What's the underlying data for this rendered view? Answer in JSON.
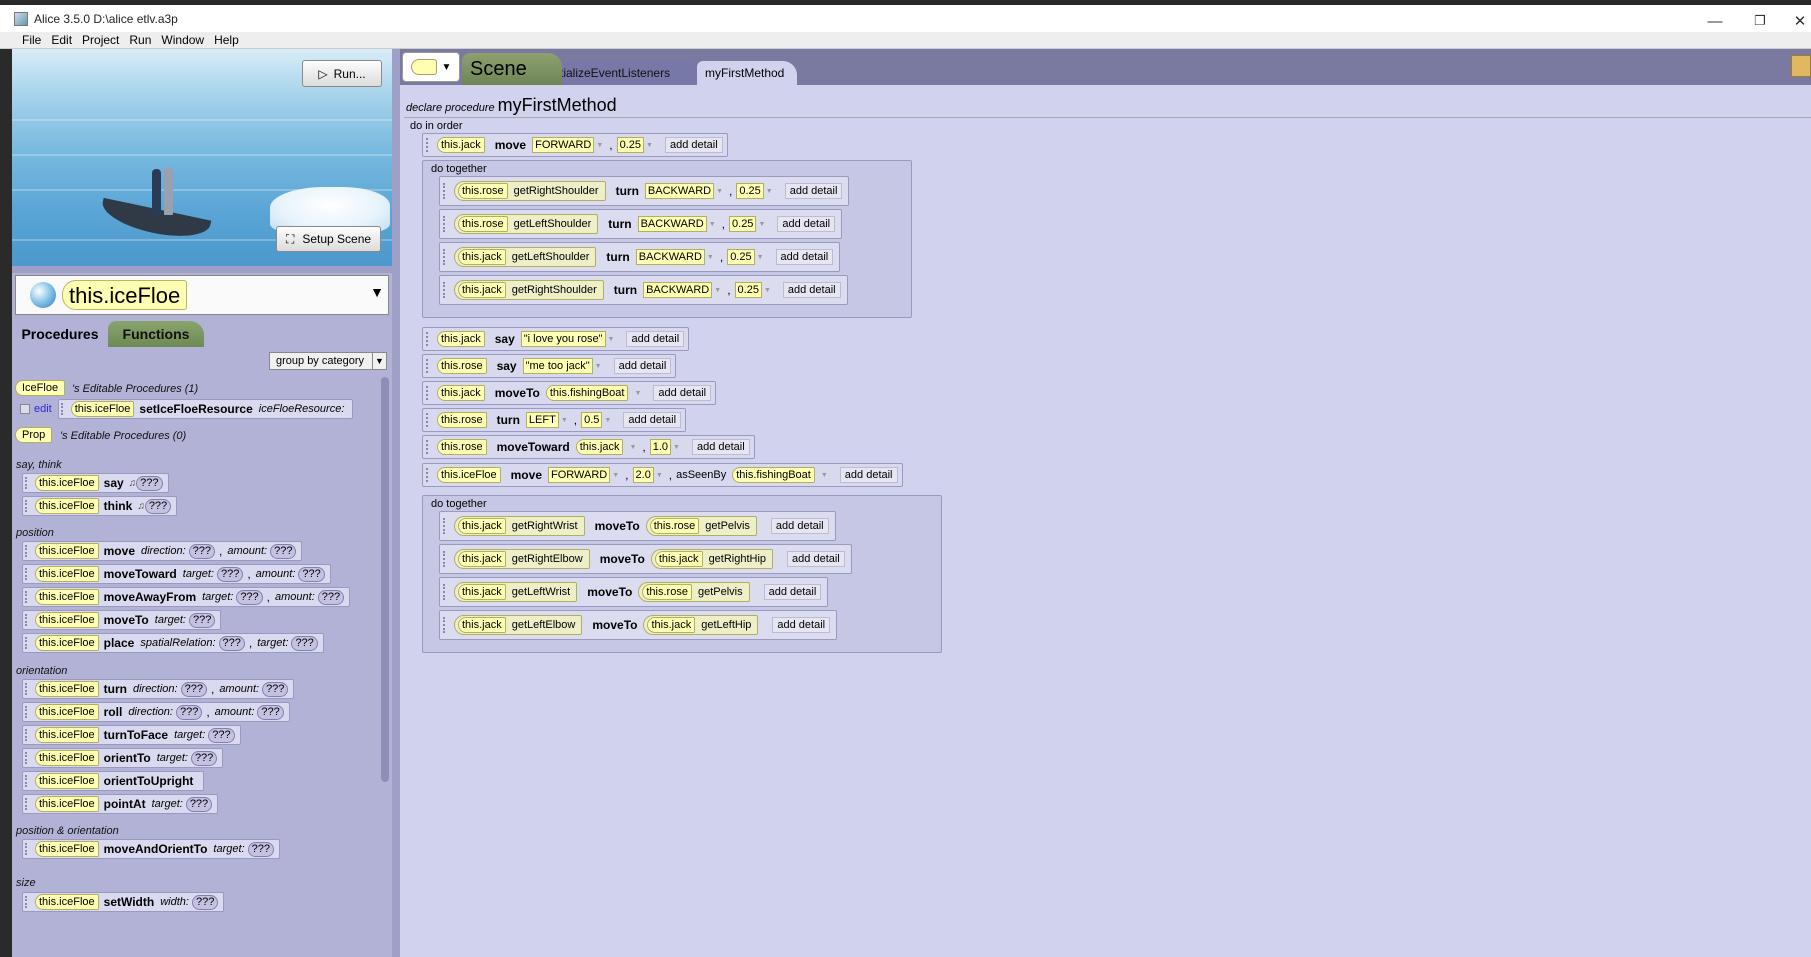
{
  "window": {
    "title": "Alice 3.5.0 D:\\alice etlv.a3p"
  },
  "menu": [
    "File",
    "Edit",
    "Project",
    "Run",
    "Window",
    "Help"
  ],
  "scene": {
    "run_label": "Run...",
    "setup_label": "Setup Scene"
  },
  "selected_object": "this.iceFloe",
  "panel_tabs": {
    "procedures": "Procedures",
    "functions": "Functions"
  },
  "group_by": "group by category",
  "editable": {
    "icefloe_chip": "IceFloe",
    "icefloe_text": "'s Editable Procedures (1)",
    "edit_label": "edit",
    "edit_target": "this.iceFloe",
    "edit_method": "setIceFloeResource",
    "edit_param": "iceFloeResource:",
    "prop_chip": "Prop",
    "prop_text": "'s Editable Procedures (0)"
  },
  "categories": {
    "say_think": "say, think",
    "position": "position",
    "orientation": "orientation",
    "pos_orient": "position & orientation",
    "size": "size"
  },
  "obj": "this.iceFloe",
  "q": "???",
  "procs": {
    "say": "say",
    "think": "think",
    "move": "move",
    "moveToward": "moveToward",
    "moveAwayFrom": "moveAwayFrom",
    "moveTo": "moveTo",
    "place": "place",
    "turn": "turn",
    "roll": "roll",
    "turnToFace": "turnToFace",
    "orientTo": "orientTo",
    "orientToUpright": "orientToUpright",
    "pointAt": "pointAt",
    "moveAndOrientTo": "moveAndOrientTo",
    "setWidth": "setWidth"
  },
  "params": {
    "direction": "direction:",
    "amount": "amount:",
    "target": "target:",
    "spatialRelation": "spatialRelation:",
    "width": "width:"
  },
  "editor_tabs": {
    "scene": "Scene",
    "init": "initializeEventListeners",
    "method": "myFirstMethod"
  },
  "declare": {
    "label": "declare procedure",
    "name": "myFirstMethod"
  },
  "do_in_order": "do in order",
  "do_together": "do together",
  "add_detail": "add detail",
  "code": {
    "jack": "this.jack",
    "rose": "this.rose",
    "iceFloe": "this.iceFloe",
    "fishingBoat": "this.fishingBoat",
    "move": "move",
    "turn": "turn",
    "say": "say",
    "moveTo": "moveTo",
    "moveToward": "moveToward",
    "asSeenBy": "asSeenBy",
    "FORWARD": "FORWARD",
    "BACKWARD": "BACKWARD",
    "LEFT": "LEFT",
    "getRightShoulder": "getRightShoulder",
    "getLeftShoulder": "getLeftShoulder",
    "getRightWrist": "getRightWrist",
    "getRightElbow": "getRightElbow",
    "getLeftWrist": "getLeftWrist",
    "getLeftElbow": "getLeftElbow",
    "getPelvis": "getPelvis",
    "getRightHip": "getRightHip",
    "getLeftHip": "getLeftHip",
    "n025": "0.25",
    "n05": "0.5",
    "n10": "1.0",
    "n20": "2.0",
    "s1": "\"i love you rose\"",
    "s2": "\"me too jack\""
  }
}
